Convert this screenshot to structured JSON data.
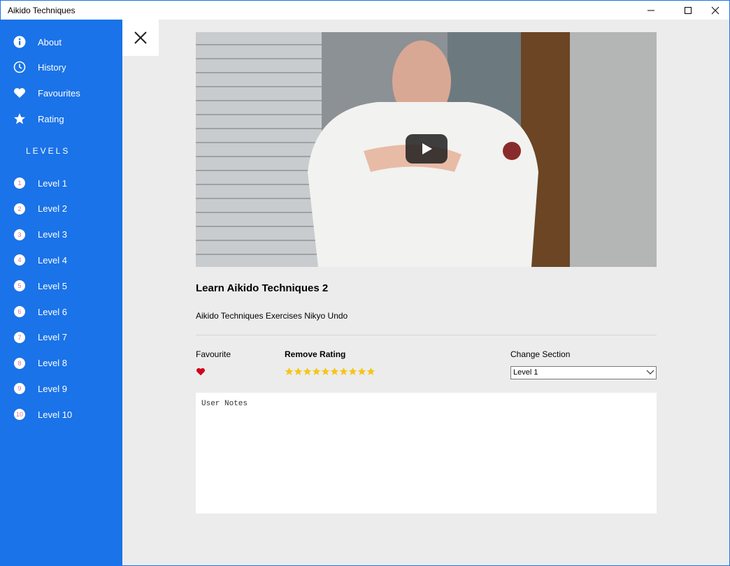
{
  "window": {
    "title": "Aikido Techniques"
  },
  "sidebar": {
    "menu": [
      {
        "label": "About",
        "icon": "info-icon"
      },
      {
        "label": "History",
        "icon": "clock-icon"
      },
      {
        "label": "Favourites",
        "icon": "heart-icon"
      },
      {
        "label": "Rating",
        "icon": "star-icon"
      }
    ],
    "levels_heading": "LEVELS",
    "levels": [
      {
        "num": "1",
        "label": "Level 1"
      },
      {
        "num": "2",
        "label": "Level 2"
      },
      {
        "num": "3",
        "label": "Level 3"
      },
      {
        "num": "4",
        "label": "Level 4"
      },
      {
        "num": "5",
        "label": "Level 5"
      },
      {
        "num": "6",
        "label": "Level 6"
      },
      {
        "num": "7",
        "label": "Level 7"
      },
      {
        "num": "8",
        "label": "Level 8"
      },
      {
        "num": "9",
        "label": "Level 9"
      },
      {
        "num": "10",
        "label": "Level 10"
      }
    ]
  },
  "video": {
    "title": "Learn Aikido Techniques 2",
    "description": "Aikido Techniques Exercises Nikyo Undo"
  },
  "controls": {
    "favourite_label": "Favourite",
    "rating_label": "Remove Rating",
    "rating_value": 10,
    "rating_max": 10,
    "section_label": "Change Section",
    "section_value": "Level 1"
  },
  "notes": {
    "placeholder": "User Notes"
  },
  "colors": {
    "accent": "#1a73e8",
    "star": "#f5c518",
    "heart": "#d0021b",
    "badge_text": "#e0709a"
  }
}
